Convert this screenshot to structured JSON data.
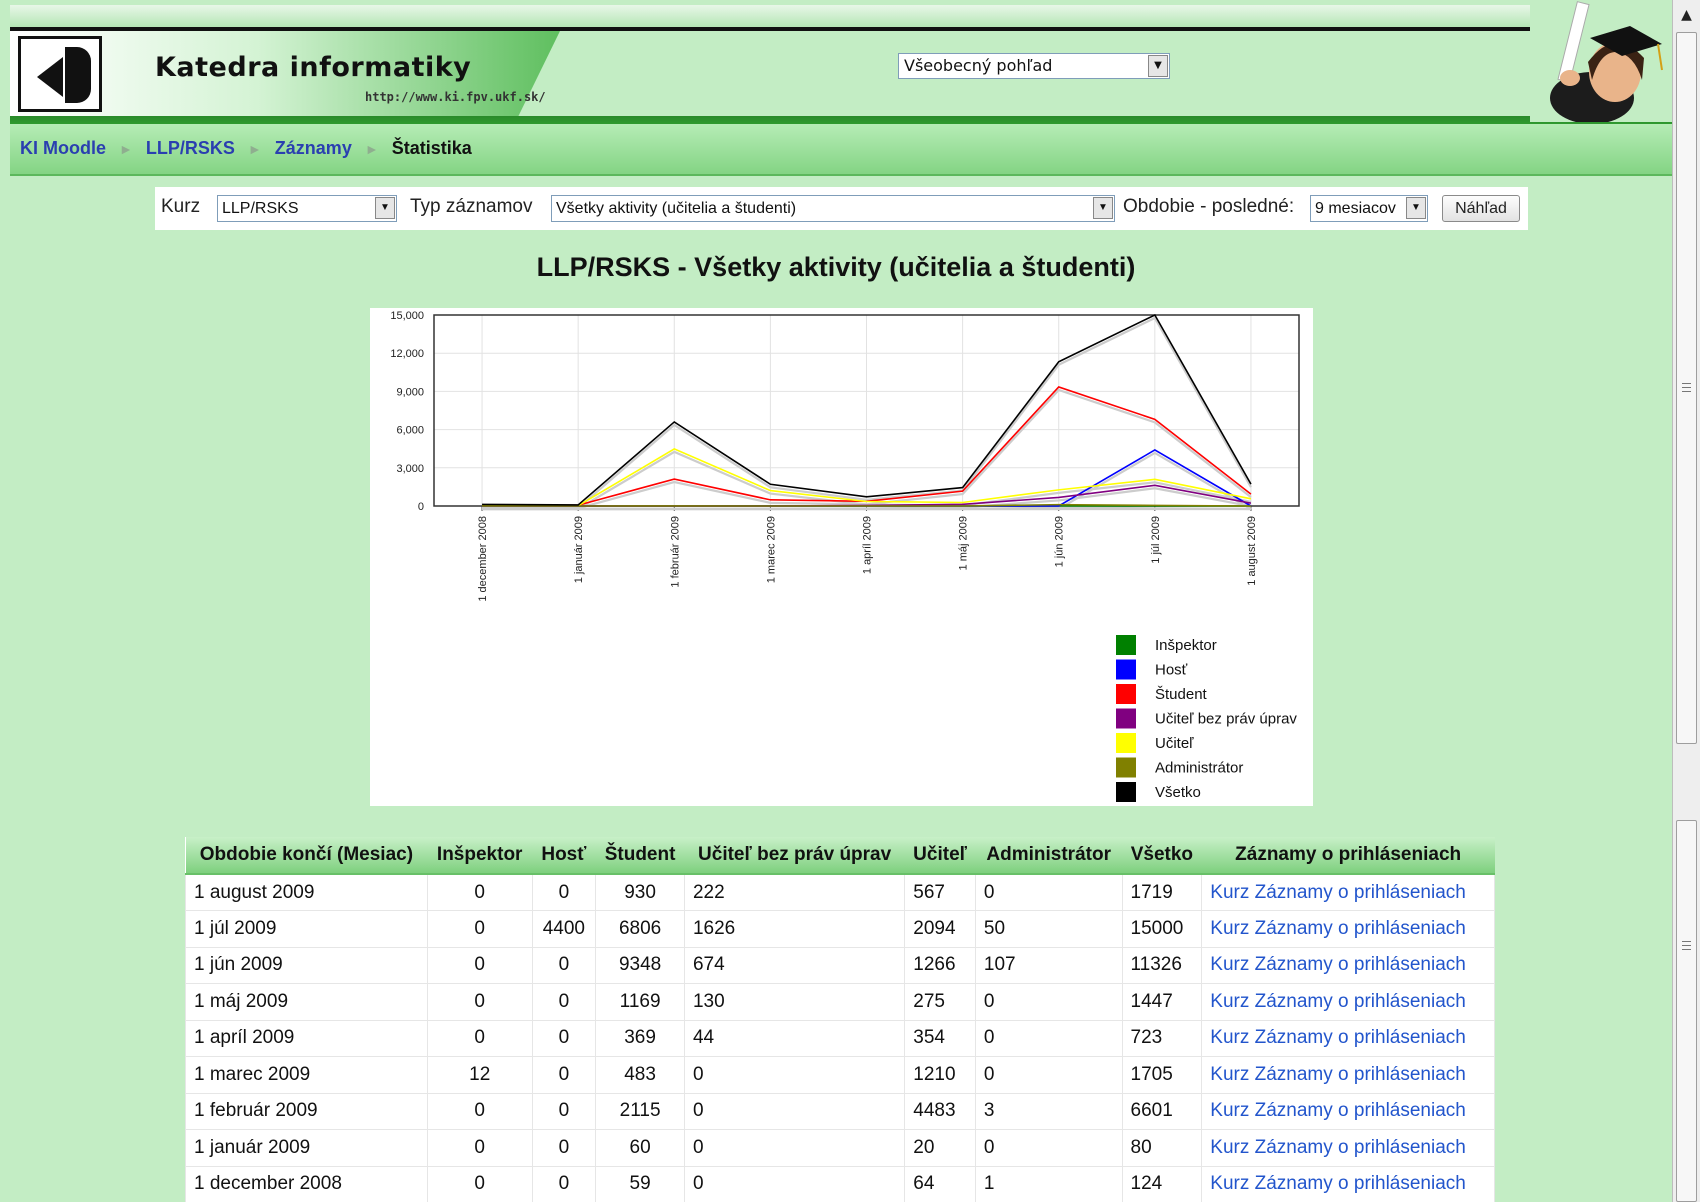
{
  "header": {
    "site_title": "Katedra informatiky",
    "site_url": "http://www.ki.fpv.ukf.sk/",
    "view_select_value": "Všeobecný pohľad"
  },
  "breadcrumb": {
    "items": [
      "KI Moodle",
      "LLP/RSKS",
      "Záznamy"
    ],
    "current": "Štatistika",
    "separator": "►"
  },
  "filter": {
    "course_label": "Kurz",
    "course_value": "LLP/RSKS",
    "type_label": "Typ záznamov",
    "type_value": "Všetky aktivity (učitelia a študenti)",
    "period_label": "Obdobie - posledné:",
    "period_value": "9 mesiacov",
    "preview_button": "Náhľad"
  },
  "chart_data": {
    "type": "line",
    "title": "LLP/RSKS - Všetky aktivity (učitelia a študenti)",
    "categories": [
      "1 december 2008",
      "1 január 2009",
      "1 február 2009",
      "1 marec 2009",
      "1 apríl 2009",
      "1 máj 2009",
      "1 jún 2009",
      "1 júl 2009",
      "1 august 2009"
    ],
    "y_ticks": [
      "0",
      "3,000",
      "6,000",
      "9,000",
      "12,000",
      "15,000"
    ],
    "ylim": [
      0,
      15000
    ],
    "grid": true,
    "legend_position": "bottom-right",
    "series": [
      {
        "name": "Inšpektor",
        "color": "#008000",
        "values": [
          0,
          0,
          0,
          12,
          0,
          0,
          0,
          0,
          0
        ]
      },
      {
        "name": "Hosť",
        "color": "#0000ff",
        "values": [
          0,
          0,
          0,
          0,
          0,
          0,
          0,
          4400,
          0
        ]
      },
      {
        "name": "Študent",
        "color": "#ff0000",
        "values": [
          59,
          60,
          2115,
          483,
          369,
          1169,
          9348,
          6806,
          930
        ]
      },
      {
        "name": "Učiteľ bez práv úprav",
        "color": "#800080",
        "values": [
          0,
          0,
          0,
          0,
          44,
          130,
          674,
          1626,
          222
        ]
      },
      {
        "name": "Učiteľ",
        "color": "#ffff00",
        "values": [
          64,
          20,
          4483,
          1210,
          354,
          275,
          1266,
          2094,
          567
        ]
      },
      {
        "name": "Administrátor",
        "color": "#808000",
        "values": [
          1,
          0,
          3,
          0,
          0,
          0,
          107,
          50,
          0
        ]
      },
      {
        "name": "Všetko",
        "color": "#000000",
        "values": [
          124,
          80,
          6601,
          1705,
          723,
          1447,
          11326,
          15000,
          1719
        ]
      }
    ]
  },
  "table": {
    "headers": [
      "Obdobie končí (Mesiac)",
      "Inšpektor",
      "Hosť",
      "Študent",
      "Učiteľ bez práv úprav",
      "Učiteľ",
      "Administrátor",
      "Všetko",
      "Záznamy o prihláseniach"
    ],
    "rows": [
      [
        "1 august 2009",
        "0",
        "0",
        "930",
        "222",
        "567",
        "0",
        "1719",
        "Kurz Záznamy o prihláseniach"
      ],
      [
        "1 júl 2009",
        "0",
        "4400",
        "6806",
        "1626",
        "2094",
        "50",
        "15000",
        "Kurz Záznamy o prihláseniach"
      ],
      [
        "1 jún 2009",
        "0",
        "0",
        "9348",
        "674",
        "1266",
        "107",
        "11326",
        "Kurz Záznamy o prihláseniach"
      ],
      [
        "1 máj 2009",
        "0",
        "0",
        "1169",
        "130",
        "275",
        "0",
        "1447",
        "Kurz Záznamy o prihláseniach"
      ],
      [
        "1 apríl 2009",
        "0",
        "0",
        "369",
        "44",
        "354",
        "0",
        "723",
        "Kurz Záznamy o prihláseniach"
      ],
      [
        "1 marec 2009",
        "12",
        "0",
        "483",
        "0",
        "1210",
        "0",
        "1705",
        "Kurz Záznamy o prihláseniach"
      ],
      [
        "1 február 2009",
        "0",
        "0",
        "2115",
        "0",
        "4483",
        "3",
        "6601",
        "Kurz Záznamy o prihláseniach"
      ],
      [
        "1 január 2009",
        "0",
        "0",
        "60",
        "0",
        "20",
        "0",
        "80",
        "Kurz Záznamy o prihláseniach"
      ],
      [
        "1 december 2008",
        "0",
        "0",
        "59",
        "0",
        "64",
        "1",
        "124",
        "Kurz Záznamy o prihláseniach"
      ]
    ]
  }
}
